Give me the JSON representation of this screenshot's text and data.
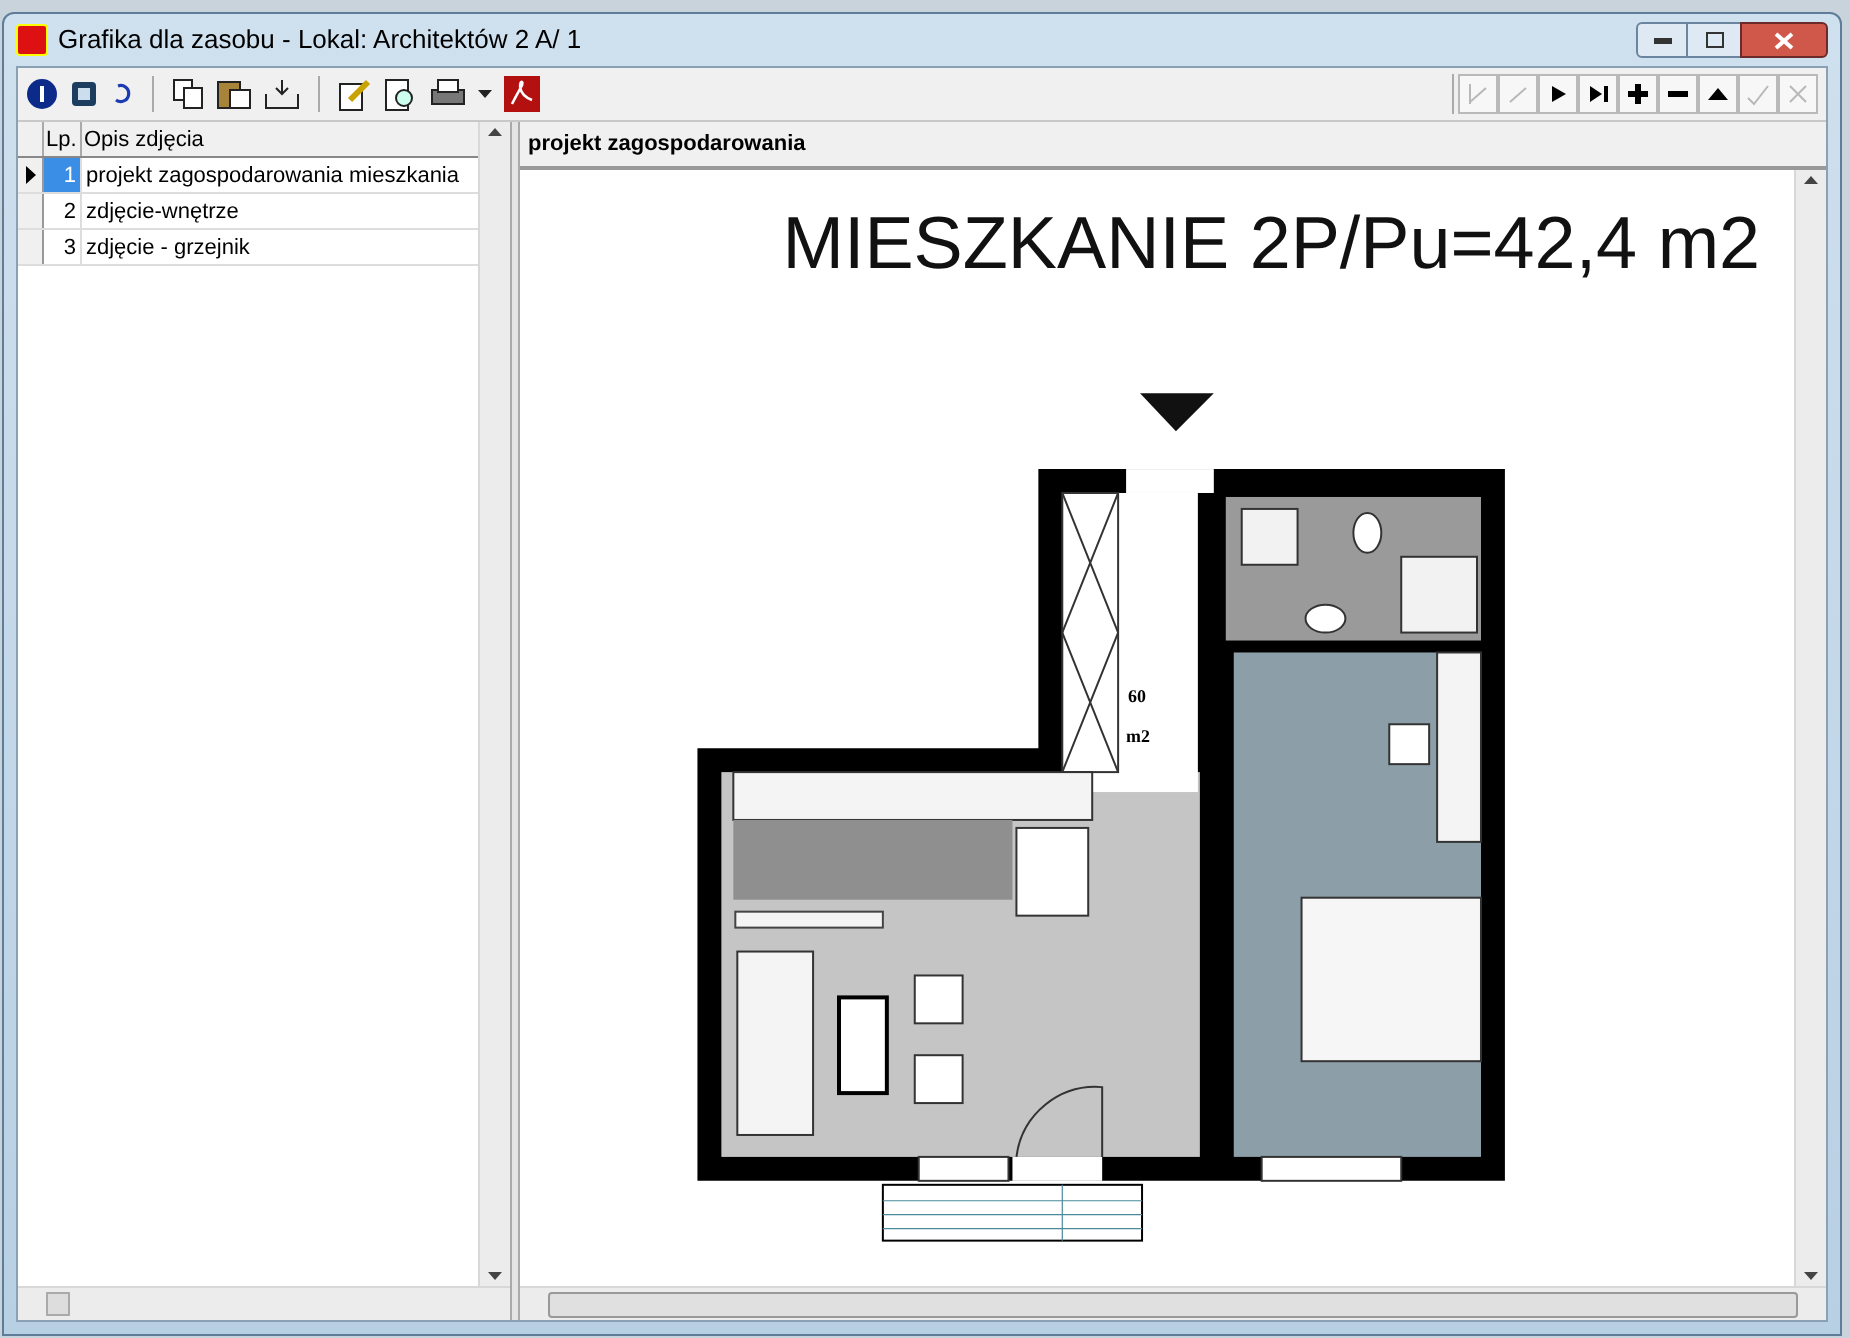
{
  "window": {
    "title": "Grafika dla zasobu - Lokal: Architektów 2 A/ 1"
  },
  "navigator": [
    {
      "kind": "first",
      "disabled": true
    },
    {
      "kind": "prior",
      "disabled": true
    },
    {
      "kind": "next",
      "disabled": false
    },
    {
      "kind": "last",
      "disabled": false
    },
    {
      "kind": "insert",
      "disabled": false
    },
    {
      "kind": "delete",
      "disabled": false
    },
    {
      "kind": "edit",
      "disabled": false
    },
    {
      "kind": "post",
      "disabled": true
    },
    {
      "kind": "cancel",
      "disabled": true
    }
  ],
  "grid": {
    "columns": [
      "Lp.",
      "Opis zdjęcia"
    ],
    "rows": [
      {
        "number": "1",
        "description": "projekt zagospodarowania mieszkania",
        "selected": true
      },
      {
        "number": "2",
        "description": "zdjęcie-wnętrze",
        "selected": false
      },
      {
        "number": "3",
        "description": "zdjęcie - grzejnik",
        "selected": false
      }
    ]
  },
  "viewer": {
    "caption": "projekt zagospodarowania",
    "plan_title": "MIESZKANIE 2P/Pu=42,4 m2",
    "area_value": "60",
    "area_unit": "m2"
  }
}
